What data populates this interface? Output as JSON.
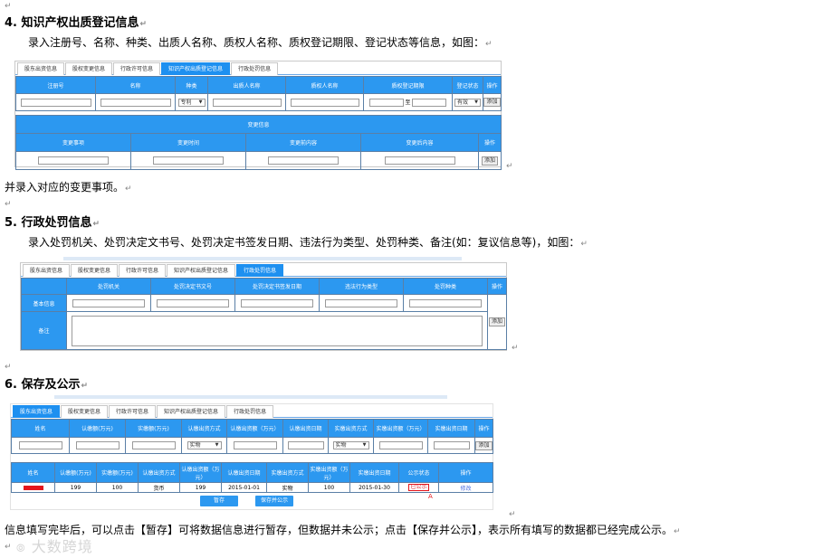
{
  "mark": "↵",
  "s4": {
    "heading": "4. 知识产权出质登记信息",
    "desc": "录入注册号、名称、种类、出质人名称、质权人名称、质权登记期限、登记状态等信息，如图：",
    "tabs": [
      "股东出资信息",
      "股权变更信息",
      "行政许可信息",
      "知识产权出质登记信息",
      "行政处罚信息"
    ],
    "cols": [
      "注册号",
      "名称",
      "种类",
      "出质人名称",
      "质权人名称",
      "质权登记期限",
      "登记状态",
      "操作"
    ],
    "type_value": "专利",
    "range_sep": "至",
    "status_value": "有效",
    "add": "添加",
    "change_title": "变更信息",
    "change_cols": [
      "变更事项",
      "变更时间",
      "变更前内容",
      "变更后内容",
      "操作"
    ],
    "after": "并录入对应的变更事项。"
  },
  "s5": {
    "heading": "5. 行政处罚信息",
    "desc": "录入处罚机关、处罚决定文书号、处罚决定书签发日期、违法行为类型、处罚种类、备注(如：复议信息等)，如图：",
    "tabs": [
      "股东出资信息",
      "股权变更信息",
      "行政许可信息",
      "知识产权出质登记信息",
      "行政处罚信息"
    ],
    "cols": [
      "处罚机关",
      "处罚决定书文号",
      "处罚决定书签发日期",
      "违法行为类型",
      "处罚种类",
      "操作"
    ],
    "row1": "基本信息",
    "row2": "备注",
    "add": "添加"
  },
  "s6": {
    "heading": "6. 保存及公示",
    "tabs": [
      "股东出资信息",
      "股权变更信息",
      "行政许可信息",
      "知识产权出质登记信息",
      "行政处罚信息"
    ],
    "cols": [
      "姓名",
      "认缴额(万元)",
      "实缴额(万元)",
      "认缴出资方式",
      "认缴出资额（万元）",
      "认缴出资日期",
      "实缴出资方式",
      "实缴出资额（万元）",
      "实缴出资日期",
      "操作"
    ],
    "sub_mode": "实物",
    "paid_mode": "实物",
    "add": "添加",
    "list_cols": [
      "姓名",
      "认缴额(万元)",
      "实缴额(万元)",
      "认缴出资方式",
      "认缴出资额（万元）",
      "认缴出资日期",
      "实缴出资方式",
      "实缴出资额（万元）",
      "实缴出资日期",
      "公示状态",
      "操作"
    ],
    "row": {
      "subscribed": "199",
      "paid": "100",
      "sub_mode": "货币",
      "sub_amount": "199",
      "sub_date": "2015-01-01",
      "paid_mode": "实物",
      "paid_amount": "100",
      "paid_date": "2015-01-30",
      "status": "已公示",
      "action": "修改"
    },
    "marker": "A",
    "save": "暂存",
    "save_publish": "保存并公示",
    "footer": "信息填写完毕后，可以点击【暂存】可将数据信息进行暂存，但数据并未公示；点击【保存并公示】，表示所有填写的数据都已经完成公示。"
  },
  "watermark": "大数跨境"
}
